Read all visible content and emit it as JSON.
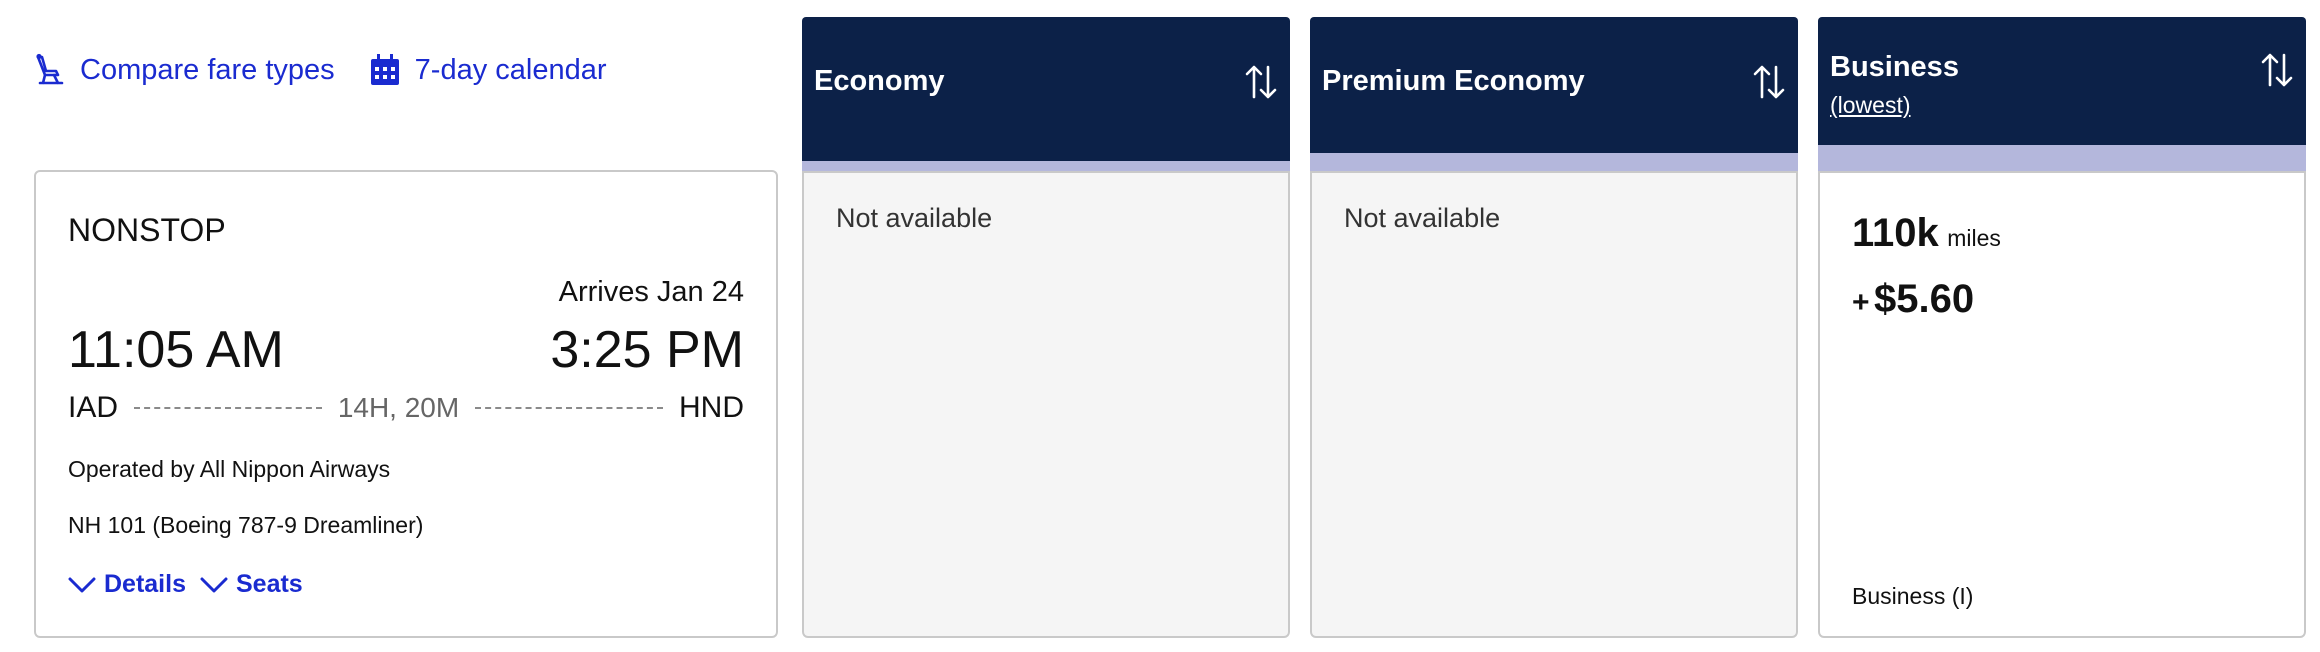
{
  "toolbar": {
    "compare_label": "Compare fare types",
    "calendar_label": "7-day calendar",
    "compare_icon": "seat-icon",
    "calendar_icon": "calendar-icon"
  },
  "flight": {
    "stops": "NONSTOP",
    "arrives": "Arrives Jan 24",
    "depart_time": "11:05 AM",
    "arrive_time": "3:25 PM",
    "origin": "IAD",
    "destination": "HND",
    "duration": "14H, 20M",
    "operated_by": "Operated by All Nippon Airways",
    "aircraft": "NH 101 (Boeing 787-9 Dreamliner)",
    "details_label": "Details",
    "seats_label": "Seats"
  },
  "columns": [
    {
      "title": "Economy",
      "subtitle": "",
      "status": "Not available"
    },
    {
      "title": "Premium Economy",
      "subtitle": "",
      "status": "Not available"
    },
    {
      "title": "Business",
      "subtitle": "(lowest)",
      "miles": "110k",
      "miles_unit": "miles",
      "cash_prefix": "+",
      "cash": "$5.60",
      "fare_class": "Business (I)"
    }
  ],
  "colors": {
    "link": "#1a2bd0",
    "header_bg": "#0c2148",
    "header_stripe": "#b4b7dc",
    "unavailable_bg": "#f5f5f5"
  }
}
